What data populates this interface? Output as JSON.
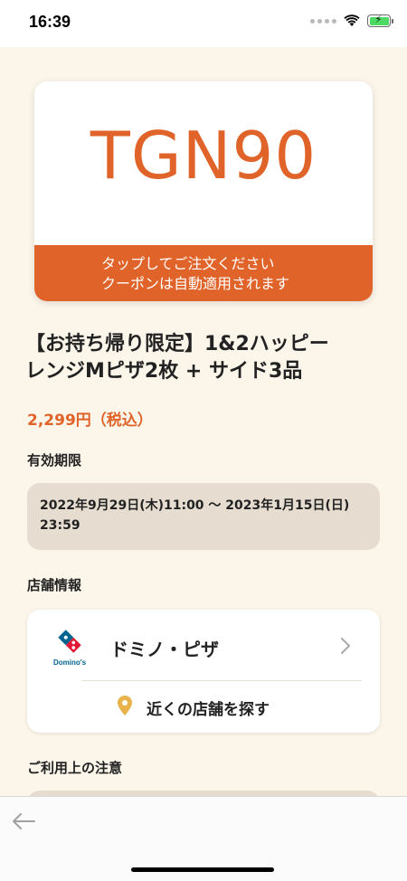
{
  "status_bar": {
    "time": "16:39"
  },
  "coupon": {
    "code": "TGN90",
    "footer_line1": "タップしてご注文ください",
    "footer_line2": "クーポンは自動適用されます"
  },
  "product": {
    "title_line1": "【お持ち帰り限定】1&2ハッピー",
    "title_line2": "レンジMピザ2枚 + サイド3品",
    "price": "2,299円（税込）"
  },
  "validity": {
    "label": "有効期限",
    "line1": "2022年9月29日(木)11:00 〜 2023年1月15日(日)",
    "line2": "23:59"
  },
  "store": {
    "label": "店舗情報",
    "name": "ドミノ・ピザ",
    "logo_text": "Domino's",
    "nearby_label": "近くの店舗を探す"
  },
  "notes": {
    "label": "ご利用上の注意"
  },
  "colors": {
    "accent": "#e0642a",
    "background": "#fbf5ea",
    "box": "#e6ddd0",
    "dominos_blue": "#006491",
    "dominos_red": "#e31837",
    "pin": "#e8b34a"
  },
  "icons": {
    "wifi": "wifi-icon",
    "battery": "battery-icon",
    "chevron": "chevron-right-icon",
    "pin": "location-pin-icon",
    "back": "back-arrow-icon"
  }
}
